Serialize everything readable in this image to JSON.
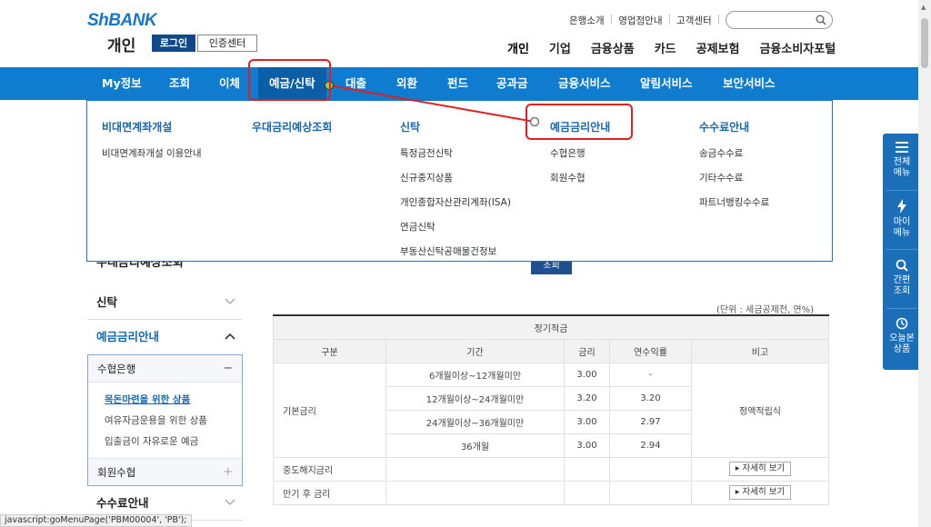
{
  "logo": {
    "brand": "ShBANK",
    "sub": "개인"
  },
  "auth": {
    "login": "로그인",
    "cert": "인증센터"
  },
  "util_links": [
    "은행소개",
    "영업점안내",
    "고객센터"
  ],
  "search": {
    "placeholder": ""
  },
  "top_menu": [
    "개인",
    "기업",
    "금융상품",
    "카드",
    "공제보험",
    "금융소비자포털"
  ],
  "nav": [
    "My정보",
    "조회",
    "이체",
    "예금/신탁",
    "대출",
    "외환",
    "펀드",
    "공과금",
    "금융서비스",
    "알림서비스",
    "보안서비스"
  ],
  "mega": {
    "col1": {
      "title": "비대면계좌개설",
      "items": [
        "비대면계좌개설 이용안내"
      ]
    },
    "col2": {
      "title": "우대금리예상조회",
      "items": []
    },
    "col3": {
      "title": "신탁",
      "items": [
        "특정금전신탁",
        "신규중지상품",
        "개인종합자산관리계좌(ISA)",
        "연금신탁",
        "부동산신탁공매물건정보"
      ]
    },
    "col4": {
      "title": "예금금리안내",
      "items": [
        "수협은행",
        "회원수협"
      ]
    },
    "col5": {
      "title": "수수료안내",
      "items": [
        "송금수수료",
        "기타수수료",
        "파트너뱅킹수수료"
      ]
    }
  },
  "lnb": {
    "head": "우대금리예상조회",
    "trust": "신탁",
    "rate": "예금금리안내",
    "sub1": {
      "title": "수협은행",
      "items": [
        "목돈마련을 위한 상품",
        "여유자금운용을 위한 상품",
        "입출금이 자유로운 예금"
      ]
    },
    "sub2": "회원수협",
    "fee": "수수료안내"
  },
  "content": {
    "search_btn": "조회",
    "unit": "(단위 : 세금공제전, 연%)",
    "table": {
      "caption": "정기적금",
      "headers": [
        "구분",
        "기간",
        "금리",
        "연수익률",
        "비고"
      ],
      "rows": [
        {
          "period": "6개월이상~12개월미만",
          "rate": "3.00",
          "yield": "-"
        },
        {
          "period": "12개월이상~24개월미만",
          "rate": "3.20",
          "yield": "3.20"
        },
        {
          "period": "24개월이상~36개월미만",
          "rate": "3.00",
          "yield": "2.97"
        },
        {
          "period": "36개월",
          "rate": "3.00",
          "yield": "2.94"
        }
      ],
      "group_label": "기본금리",
      "note": "정액적립식",
      "extra_rows": [
        "중도해지금리",
        "만기 후 금리"
      ],
      "detail_btn": "▸ 자세히 보기"
    }
  },
  "quick": [
    {
      "line1": "전체",
      "line2": "메뉴"
    },
    {
      "line1": "마이",
      "line2": "메뉴"
    },
    {
      "line1": "간편",
      "line2": "조회"
    },
    {
      "line1": "오늘본",
      "line2": "상품"
    }
  ],
  "status": "javascript:goMenuPage('PBM00004', 'PB');",
  "colors": {
    "nav": "#0f7ccf",
    "accent": "#1668b4",
    "highlight": "#e02020"
  }
}
